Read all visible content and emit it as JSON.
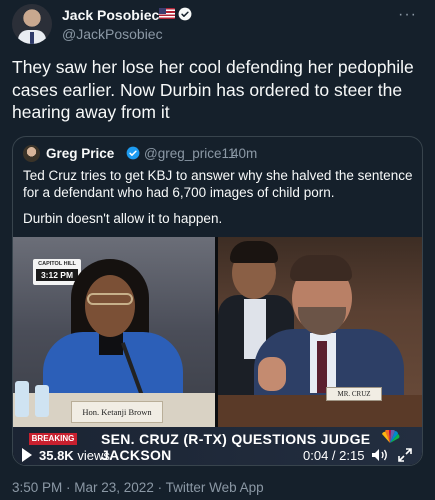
{
  "author": {
    "name": "Jack Posobiec",
    "handle": "@JackPosobiec"
  },
  "tweet": {
    "text": "They saw her lose her cool defending her pedophile cases earlier. Now Durbin has ordered to steer the hearing away from it",
    "timestamp": "3:50 PM · Mar 23, 2022 · Twitter Web App"
  },
  "quote": {
    "name": "Greg Price",
    "handle": "@greg_price11",
    "separator": "·",
    "time": "40m",
    "text_1": "Ted Cruz tries to get KBJ to answer why she halved the sentence for a defendant who had 6,700 images of child porn.",
    "text_2": "Durbin doesn't allow it to happen."
  },
  "video": {
    "capitol_label": "CAPITOL HILL",
    "clock": "3:12 PM",
    "nameplate_left": "Hon. Ketanji Brown Jackson",
    "nameplate_right": "MR. CRUZ",
    "breaking_label": "BREAKING",
    "chyron": "SEN. CRUZ (R-TX) QUESTIONS JUDGE JACKSON",
    "views_count": "35.8K",
    "views_label": "views",
    "elapsed": "0:04",
    "total": "2:15",
    "progress_fraction": 0.03
  },
  "icons": {
    "verified": "verified-badge-icon",
    "flag": "us-flag-icon",
    "more": "more-options-icon",
    "play": "play-icon",
    "volume": "volume-icon",
    "expand": "fullscreen-icon"
  },
  "colors": {
    "background": "#15202b",
    "text_primary": "#f7f9f9",
    "text_secondary": "#8b98a5",
    "border": "#38444d",
    "verified": "#1d9bf0"
  }
}
